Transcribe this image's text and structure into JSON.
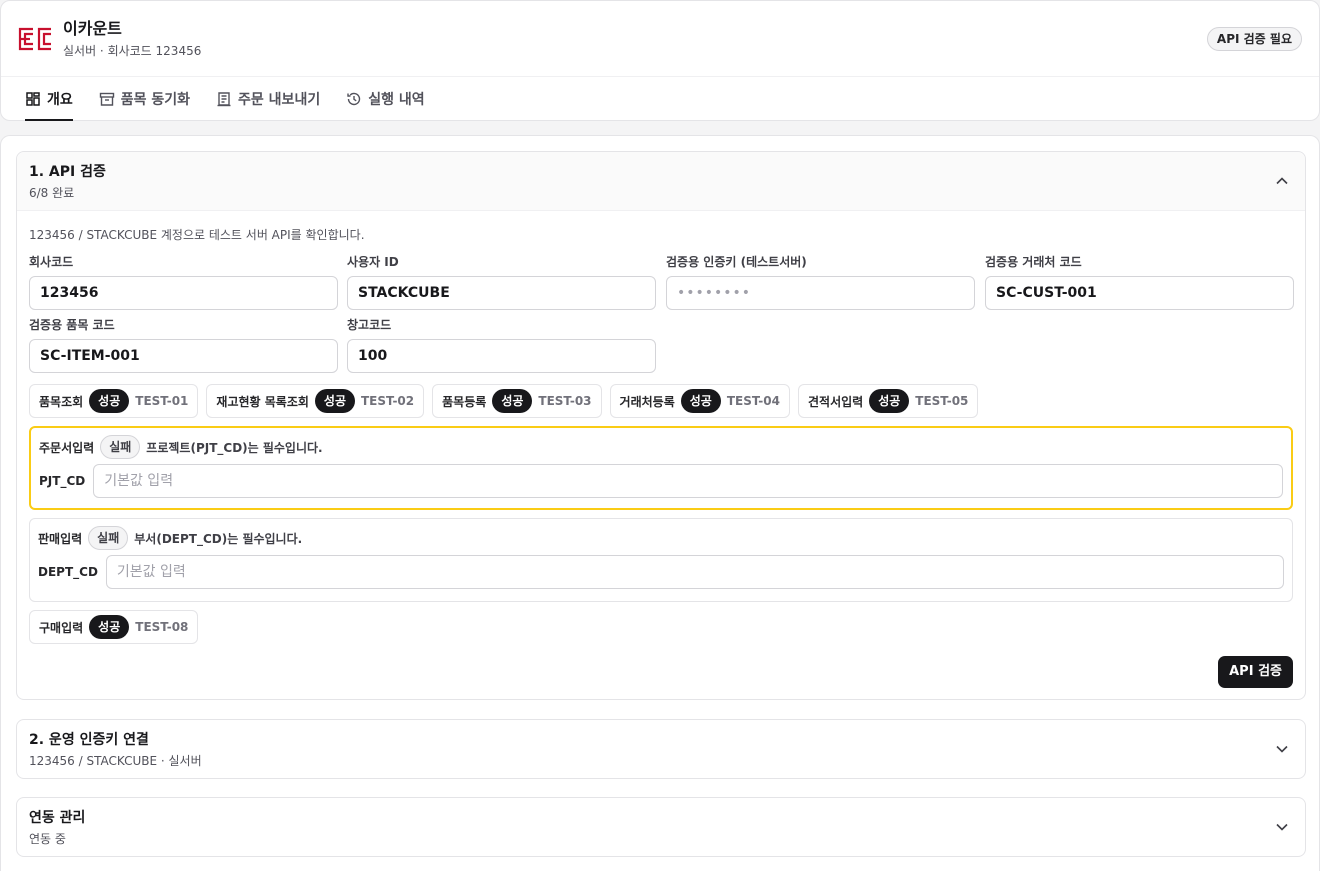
{
  "header": {
    "title": "이카운트",
    "subtitle": "실서버 · 회사코드 123456",
    "badge": "API 검증 필요",
    "brand_color": "#c8102e"
  },
  "tabs": [
    {
      "label": "개요",
      "icon": "dashboard-icon",
      "active": true
    },
    {
      "label": "품목 동기화",
      "icon": "archive-icon",
      "active": false
    },
    {
      "label": "주문 내보내기",
      "icon": "document-icon",
      "active": false
    },
    {
      "label": "실행 내역",
      "icon": "history-icon",
      "active": false
    }
  ],
  "api_verify": {
    "title": "1. API 검증",
    "progress": "6/8 완료",
    "description": "123456 / STACKCUBE 계정으로 테스트 서버 API를 확인합니다.",
    "fields": {
      "company_code": {
        "label": "회사코드",
        "value": "123456"
      },
      "user_id": {
        "label": "사용자 ID",
        "value": "STACKCUBE"
      },
      "auth_key": {
        "label": "검증용 인증키 (테스트서버)",
        "value": "••••••••"
      },
      "customer_code": {
        "label": "검증용 거래처 코드",
        "value": "SC-CUST-001"
      },
      "item_code": {
        "label": "검증용 품목 코드",
        "value": "SC-ITEM-001"
      },
      "warehouse_code": {
        "label": "창고코드",
        "value": "100"
      }
    },
    "tests": [
      {
        "name": "품목조회",
        "status": "성공",
        "code": "TEST-01"
      },
      {
        "name": "재고현황 목록조회",
        "status": "성공",
        "code": "TEST-02"
      },
      {
        "name": "품목등록",
        "status": "성공",
        "code": "TEST-03"
      },
      {
        "name": "거래처등록",
        "status": "성공",
        "code": "TEST-04"
      },
      {
        "name": "견적서입력",
        "status": "성공",
        "code": "TEST-05"
      }
    ],
    "failures": [
      {
        "name": "주문서입력",
        "status": "실패",
        "message": "프로젝트(PJT_CD)는 필수입니다.",
        "field": "PJT_CD",
        "placeholder": "기본값 입력"
      },
      {
        "name": "판매입력",
        "status": "실패",
        "message": "부서(DEPT_CD)는 필수입니다.",
        "field": "DEPT_CD",
        "placeholder": "기본값 입력"
      }
    ],
    "last_test": {
      "name": "구매입력",
      "status": "성공",
      "code": "TEST-08"
    },
    "button": "API 검증"
  },
  "prod_key": {
    "title": "2. 운영 인증키 연결",
    "subtitle": "123456 / STACKCUBE · 실서버"
  },
  "link_mgmt": {
    "title": "연동 관리",
    "subtitle": "연동 중"
  }
}
